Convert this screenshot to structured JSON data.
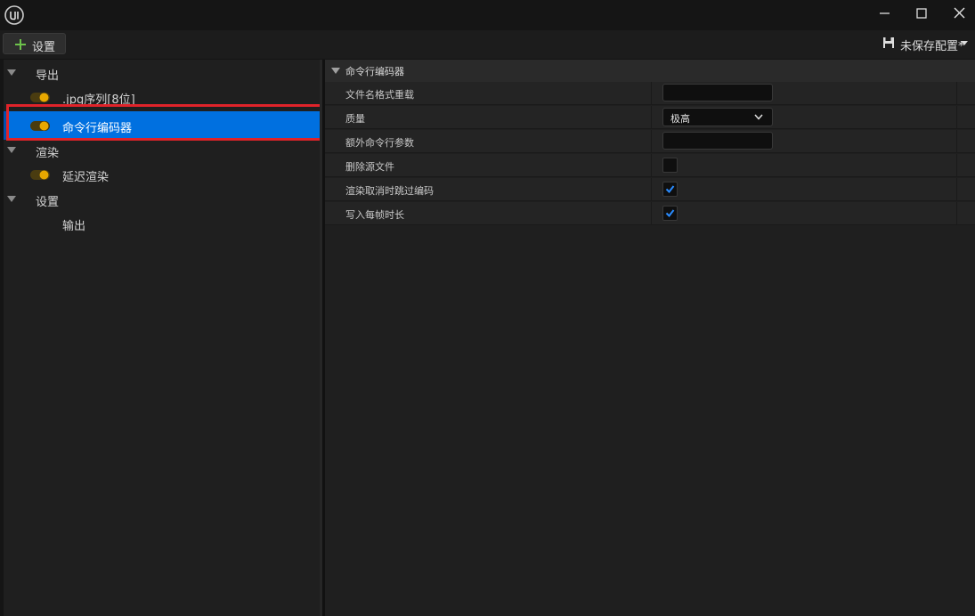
{
  "toolbar": {
    "add_label": "设置",
    "preset_label": "未保存配置*"
  },
  "tree": {
    "items": [
      {
        "label": "导出",
        "type": "category"
      },
      {
        "label": ".jpg序列[8位]",
        "type": "setting",
        "toggle": true
      },
      {
        "label": "命令行编码器",
        "type": "setting",
        "toggle": true,
        "selected": true
      },
      {
        "label": "渲染",
        "type": "category"
      },
      {
        "label": "延迟渲染",
        "type": "setting",
        "toggle": true
      },
      {
        "label": "设置",
        "type": "category"
      },
      {
        "label": "输出",
        "type": "setting",
        "toggle": false
      }
    ]
  },
  "details": {
    "category_title": "命令行编码器",
    "properties": [
      {
        "name": "文件名格式重载",
        "kind": "text",
        "value": ""
      },
      {
        "name": "质量",
        "kind": "combo",
        "value": "极高"
      },
      {
        "name": "额外命令行参数",
        "kind": "text",
        "value": ""
      },
      {
        "name": "删除源文件",
        "kind": "checkbox",
        "checked": false
      },
      {
        "name": "渲染取消时跳过编码",
        "kind": "checkbox",
        "checked": true
      },
      {
        "name": "写入每帧时长",
        "kind": "checkbox",
        "checked": true
      }
    ]
  },
  "colors": {
    "accent_blue": "#0070e0",
    "toggle_on": "#e8a800",
    "highlight_red": "#e0232a",
    "add_green": "#6dc24b",
    "check_blue": "#2a8cff"
  }
}
